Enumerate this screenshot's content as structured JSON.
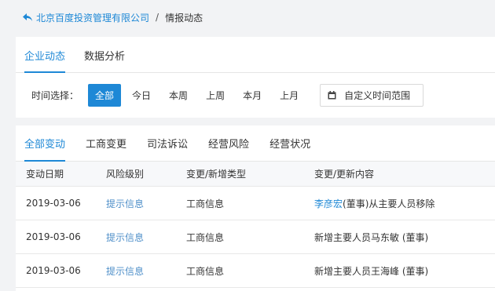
{
  "breadcrumb": {
    "company": "北京百度投资管理有限公司",
    "separator": "/",
    "current": "情报动态"
  },
  "top_tabs": [
    {
      "label": "企业动态",
      "active": true
    },
    {
      "label": "数据分析",
      "active": false
    }
  ],
  "filter": {
    "label": "时间选择：",
    "options": [
      {
        "label": "全部",
        "active": true
      },
      {
        "label": "今日",
        "active": false
      },
      {
        "label": "本周",
        "active": false
      },
      {
        "label": "上周",
        "active": false
      },
      {
        "label": "本月",
        "active": false
      },
      {
        "label": "上月",
        "active": false
      }
    ],
    "custom_range": "自定义时间范围"
  },
  "change_tabs": [
    {
      "label": "全部变动",
      "active": true
    },
    {
      "label": "工商变更",
      "active": false
    },
    {
      "label": "司法诉讼",
      "active": false
    },
    {
      "label": "经营风险",
      "active": false
    },
    {
      "label": "经营状况",
      "active": false
    }
  ],
  "table": {
    "headers": [
      "变动日期",
      "风险级别",
      "变更/新增类型",
      "变更/更新内容"
    ],
    "rows": [
      {
        "date": "2019-03-06",
        "risk": "提示信息",
        "type": "工商信息",
        "content_link": "李彦宏",
        "content": "(董事)从主要人员移除"
      },
      {
        "date": "2019-03-06",
        "risk": "提示信息",
        "type": "工商信息",
        "content_link": "",
        "content": "新增主要人员马东敏 (董事)"
      },
      {
        "date": "2019-03-06",
        "risk": "提示信息",
        "type": "工商信息",
        "content_link": "",
        "content": "新增主要人员王海峰 (董事)"
      }
    ]
  },
  "colors": {
    "accent": "#1e88d6",
    "background": "#f2f3f5"
  }
}
